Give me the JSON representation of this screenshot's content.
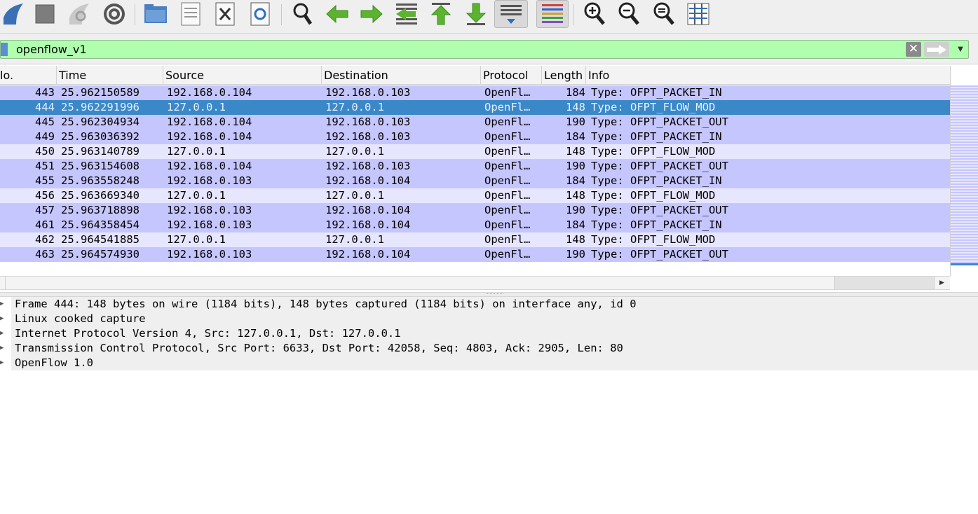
{
  "filter": {
    "value": "openflow_v1",
    "clear_glyph": "✕"
  },
  "columns": {
    "no": "lo.",
    "time": "Time",
    "source": "Source",
    "destination": "Destination",
    "protocol": "Protocol",
    "length": "Length",
    "info": "Info"
  },
  "packets": [
    {
      "no": "443",
      "time": "25.962150589",
      "src": "192.168.0.104",
      "dst": "192.168.0.103",
      "proto": "OpenFl…",
      "len": "184",
      "info": "Type: OFPT_PACKET_IN",
      "kind": "tcp"
    },
    {
      "no": "444",
      "time": "25.962291996",
      "src": "127.0.0.1",
      "dst": "127.0.0.1",
      "proto": "OpenFl…",
      "len": "148",
      "info": "Type: OFPT_FLOW_MOD",
      "kind": "selected"
    },
    {
      "no": "445",
      "time": "25.962304934",
      "src": "192.168.0.104",
      "dst": "192.168.0.103",
      "proto": "OpenFl…",
      "len": "190",
      "info": "Type: OFPT_PACKET_OUT",
      "kind": "tcp"
    },
    {
      "no": "449",
      "time": "25.963036392",
      "src": "192.168.0.104",
      "dst": "192.168.0.103",
      "proto": "OpenFl…",
      "len": "184",
      "info": "Type: OFPT_PACKET_IN",
      "kind": "tcp"
    },
    {
      "no": "450",
      "time": "25.963140789",
      "src": "127.0.0.1",
      "dst": "127.0.0.1",
      "proto": "OpenFl…",
      "len": "148",
      "info": "Type: OFPT_FLOW_MOD",
      "kind": "loop"
    },
    {
      "no": "451",
      "time": "25.963154608",
      "src": "192.168.0.104",
      "dst": "192.168.0.103",
      "proto": "OpenFl…",
      "len": "190",
      "info": "Type: OFPT_PACKET_OUT",
      "kind": "tcp"
    },
    {
      "no": "455",
      "time": "25.963558248",
      "src": "192.168.0.103",
      "dst": "192.168.0.104",
      "proto": "OpenFl…",
      "len": "184",
      "info": "Type: OFPT_PACKET_IN",
      "kind": "tcp"
    },
    {
      "no": "456",
      "time": "25.963669340",
      "src": "127.0.0.1",
      "dst": "127.0.0.1",
      "proto": "OpenFl…",
      "len": "148",
      "info": "Type: OFPT_FLOW_MOD",
      "kind": "loop"
    },
    {
      "no": "457",
      "time": "25.963718898",
      "src": "192.168.0.103",
      "dst": "192.168.0.104",
      "proto": "OpenFl…",
      "len": "190",
      "info": "Type: OFPT_PACKET_OUT",
      "kind": "tcp"
    },
    {
      "no": "461",
      "time": "25.964358454",
      "src": "192.168.0.103",
      "dst": "192.168.0.104",
      "proto": "OpenFl…",
      "len": "184",
      "info": "Type: OFPT_PACKET_IN",
      "kind": "tcp"
    },
    {
      "no": "462",
      "time": "25.964541885",
      "src": "127.0.0.1",
      "dst": "127.0.0.1",
      "proto": "OpenFl…",
      "len": "148",
      "info": "Type: OFPT_FLOW_MOD",
      "kind": "loop"
    },
    {
      "no": "463",
      "time": "25.964574930",
      "src": "192.168.0.103",
      "dst": "192.168.0.104",
      "proto": "OpenFl…",
      "len": "190",
      "info": "Type: OFPT_PACKET_OUT",
      "kind": "tcp"
    }
  ],
  "details": [
    "Frame 444: 148 bytes on wire (1184 bits), 148 bytes captured (1184 bits) on interface any, id 0",
    "Linux cooked capture",
    "Internet Protocol Version 4, Src: 127.0.0.1, Dst: 127.0.0.1",
    "Transmission Control Protocol, Src Port: 6633, Dst Port: 42058, Seq: 4803, Ack: 2905, Len: 80",
    "OpenFlow 1.0"
  ],
  "colors": {
    "tcp_row": "#c6c6ff",
    "loopback_row": "#e7e6ff",
    "selected_row": "#3a88c8",
    "filter_valid": "#afffaf"
  }
}
